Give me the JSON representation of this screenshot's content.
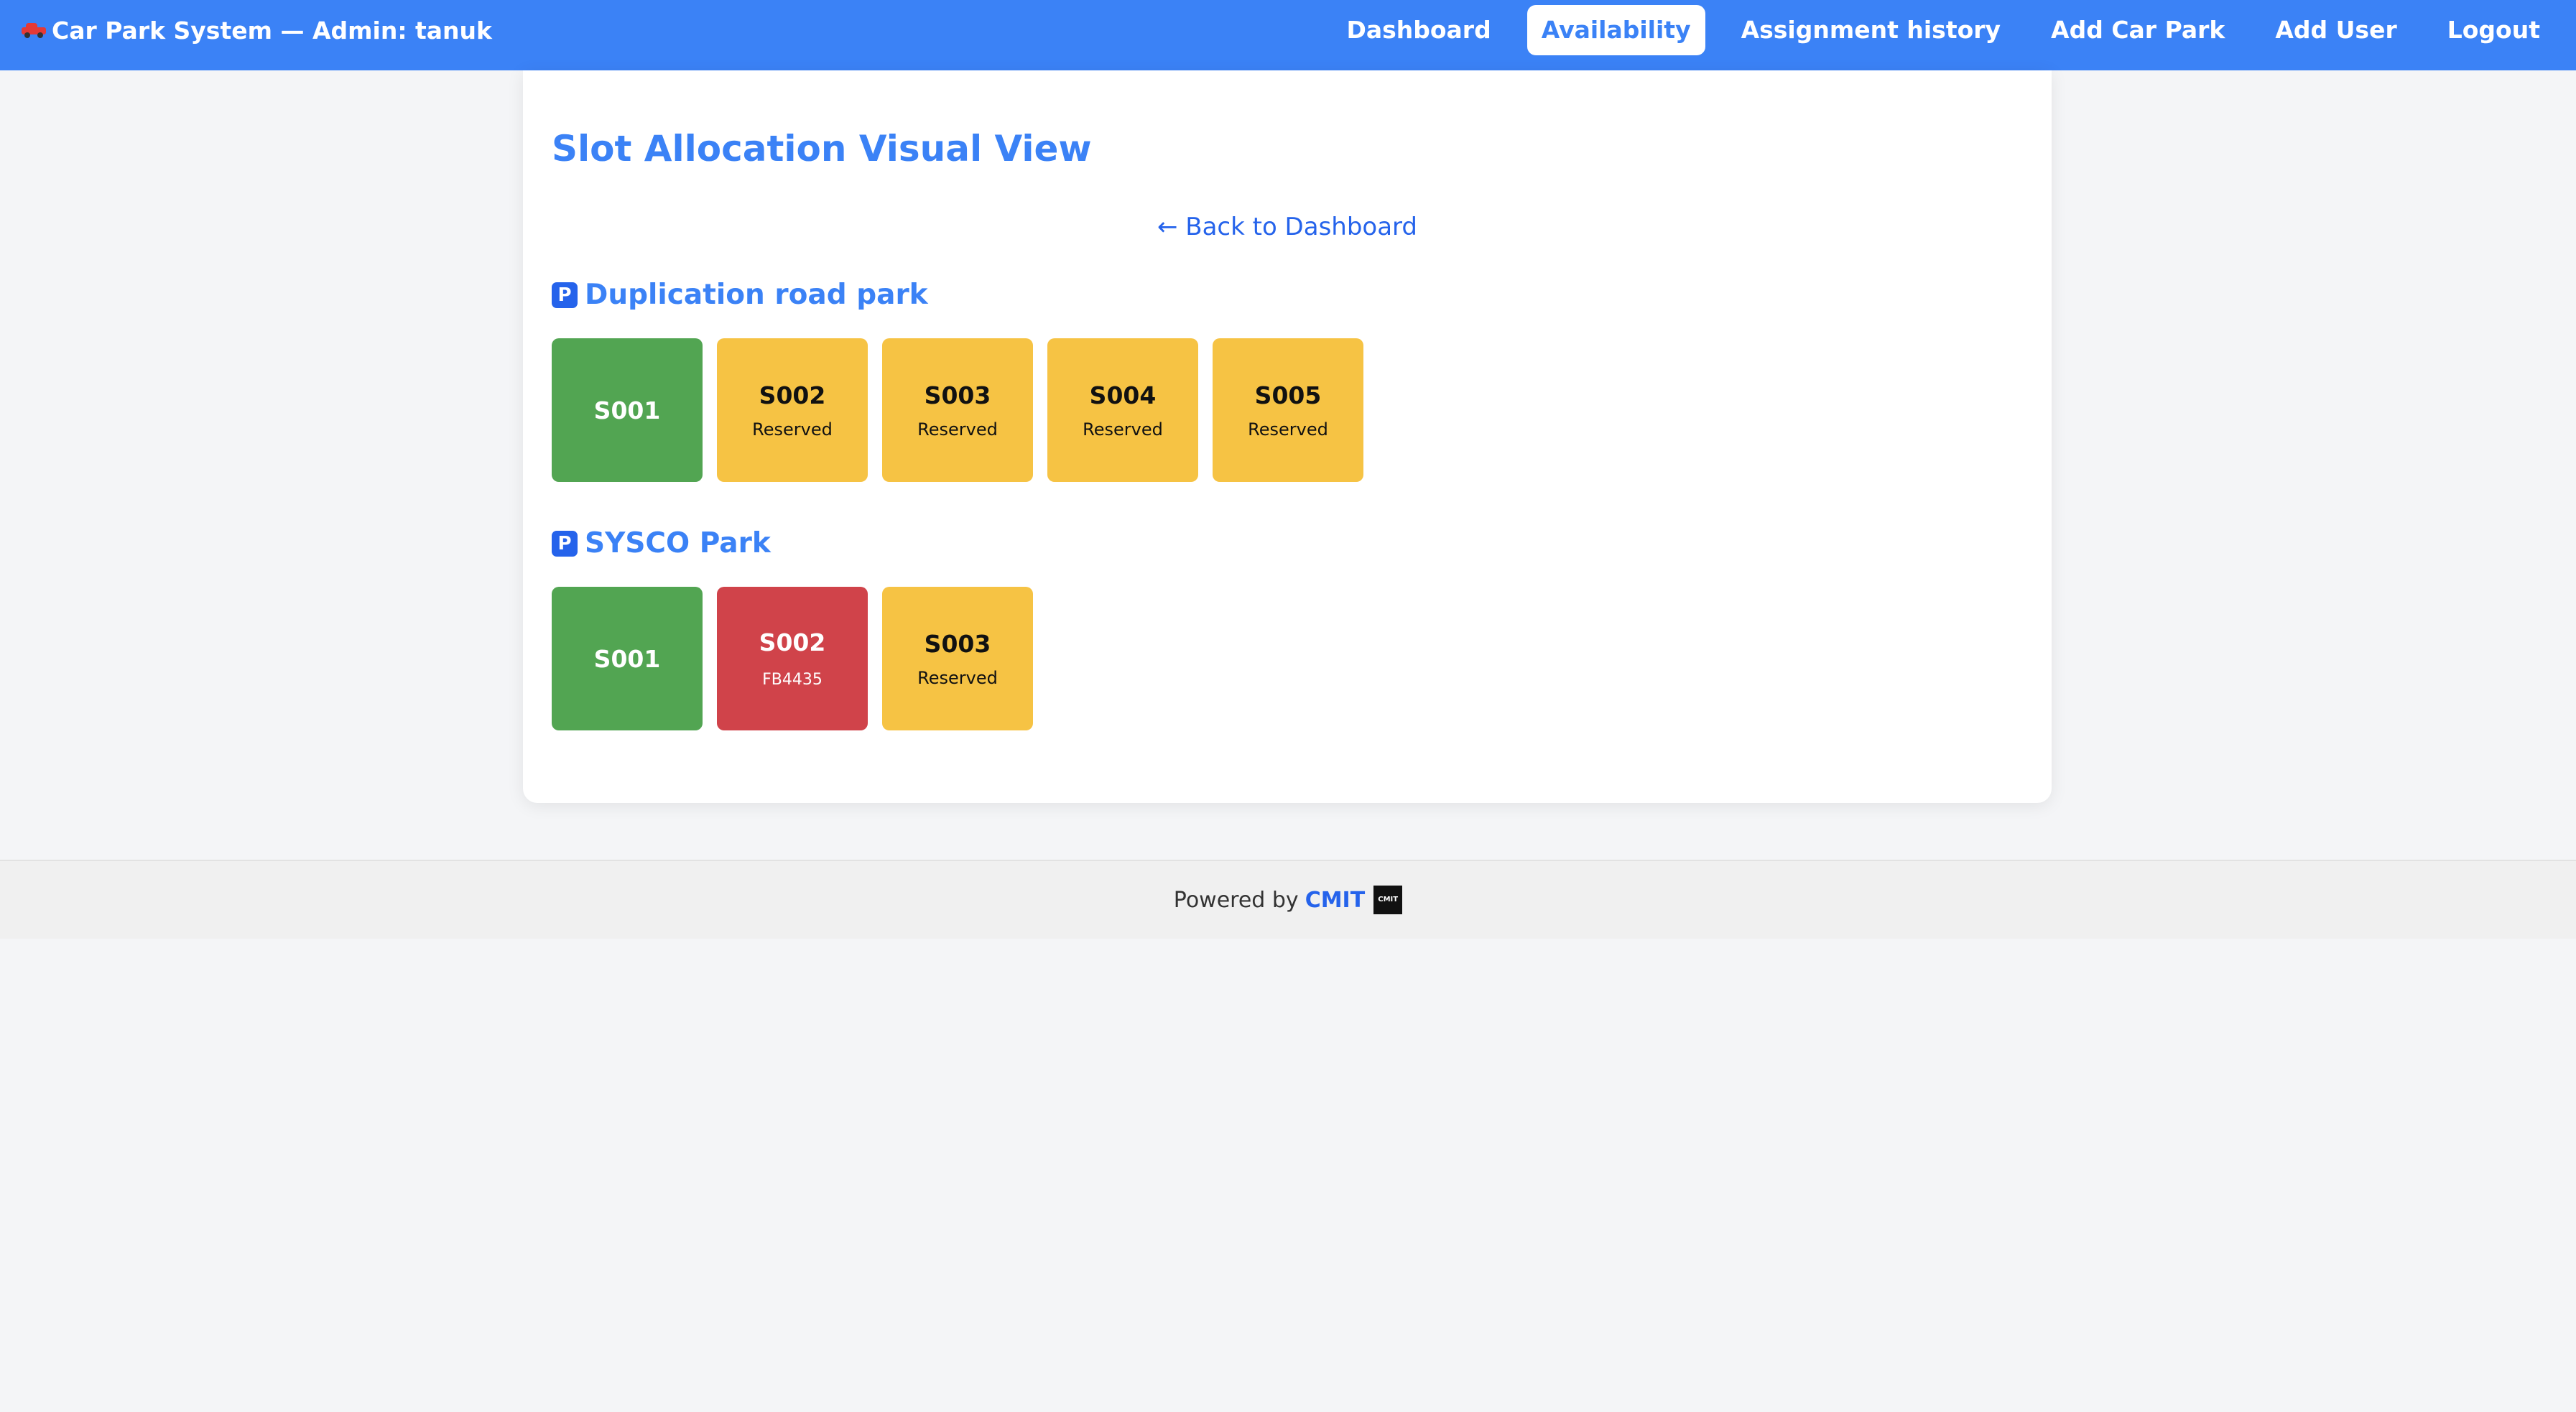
{
  "app": {
    "title": "Car Park System — Admin: tanuk",
    "icon": "car-icon"
  },
  "nav": {
    "items": [
      {
        "label": "Dashboard",
        "active": false
      },
      {
        "label": "Availability",
        "active": true
      },
      {
        "label": "Assignment history",
        "active": false
      },
      {
        "label": "Add Car Park",
        "active": false
      },
      {
        "label": "Add User",
        "active": false
      },
      {
        "label": "Logout",
        "active": false
      }
    ]
  },
  "page": {
    "title": "Slot Allocation Visual View",
    "back_link": "← Back to Dashboard"
  },
  "parks": [
    {
      "icon_label": "P",
      "name": "Duplication road park",
      "slots": [
        {
          "code": "S001",
          "status": "available",
          "sub": ""
        },
        {
          "code": "S002",
          "status": "reserved",
          "sub": "Reserved"
        },
        {
          "code": "S003",
          "status": "reserved",
          "sub": "Reserved"
        },
        {
          "code": "S004",
          "status": "reserved",
          "sub": "Reserved"
        },
        {
          "code": "S005",
          "status": "reserved",
          "sub": "Reserved"
        }
      ]
    },
    {
      "icon_label": "P",
      "name": "SYSCO Park",
      "slots": [
        {
          "code": "S001",
          "status": "available",
          "sub": ""
        },
        {
          "code": "S002",
          "status": "occupied",
          "sub": "FB4435"
        },
        {
          "code": "S003",
          "status": "reserved",
          "sub": "Reserved"
        }
      ]
    }
  ],
  "footer": {
    "powered_by": "Powered by",
    "brand": "CMIT",
    "logo_text": "CMIT"
  },
  "colors": {
    "primary": "#3b82f6",
    "available": "#52a552",
    "reserved": "#f6c344",
    "occupied": "#d0434a"
  }
}
